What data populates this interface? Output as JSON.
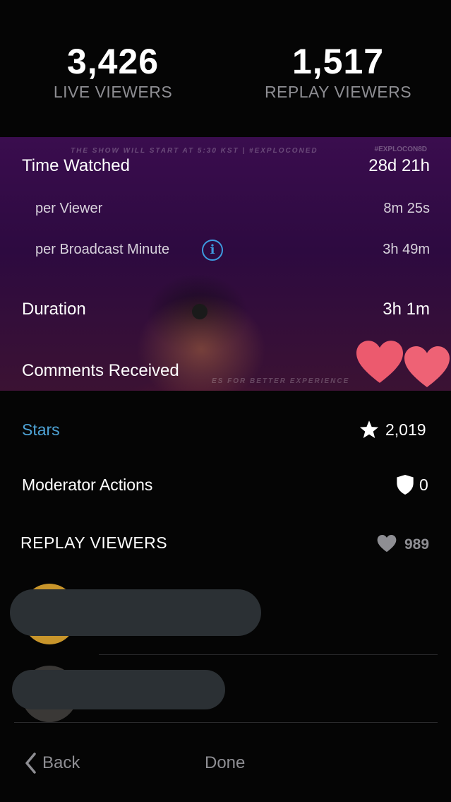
{
  "header": {
    "live_count": "3,426",
    "live_label": "LIVE VIEWERS",
    "replay_count": "1,517",
    "replay_label": "REPLAY VIEWERS"
  },
  "video": {
    "caption": "THE SHOW WILL START AT 5:30 KST | #EXPLOCONED",
    "hashtag": "#EXPLOCON8D",
    "footer_text": "ES FOR BETTER EXPERIENCE"
  },
  "stats": {
    "time_watched_label": "Time Watched",
    "time_watched_value": "28d 21h",
    "per_viewer_label": "per Viewer",
    "per_viewer_value": "8m 25s",
    "per_broadcast_label": "per Broadcast Minute",
    "per_broadcast_value": "3h 49m",
    "duration_label": "Duration",
    "duration_value": "3h 1m",
    "comments_label": "Comments Received"
  },
  "stars": {
    "label": "Stars",
    "value": "2,019"
  },
  "moderator": {
    "label": "Moderator Actions",
    "value": "0"
  },
  "replay_section": {
    "label": "REPLAY VIEWERS",
    "likes": "989"
  },
  "nav": {
    "back_label": "Back",
    "done_label": "Done"
  },
  "colors": {
    "accent": "#4ea3d6",
    "info": "#3d9be0",
    "heart": "#ec5a6e"
  },
  "icons": [
    "info-icon",
    "star-icon",
    "shield-icon",
    "heart-icon",
    "chevron-left-icon"
  ]
}
